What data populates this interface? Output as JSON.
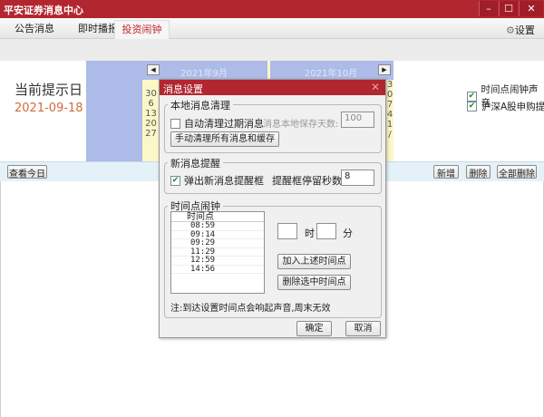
{
  "window": {
    "title": "平安证券消息中心",
    "minimize": "–",
    "maximize": "☐",
    "close": "✕"
  },
  "tabs": [
    {
      "label": "公告消息"
    },
    {
      "label": "即时播报"
    },
    {
      "label": "投资闹钟",
      "active": true
    }
  ],
  "settings": {
    "icon": "gear-icon",
    "label": "设置"
  },
  "left_panel": {
    "label": "当前提示日",
    "date": "2021-09-18"
  },
  "calendar": {
    "month1": "2021年9月",
    "month2": "2021年10月",
    "col1": [
      "30",
      "6",
      "13",
      "20",
      "27"
    ],
    "col2": [
      "3",
      "0",
      "7",
      "4",
      "1",
      "/"
    ]
  },
  "options": [
    {
      "label": "时间点闹钟声音",
      "checked": true
    },
    {
      "label": "沪深A股申购提醒",
      "checked": true
    }
  ],
  "toolbar": {
    "today": "查看今日",
    "add": "新增",
    "delete": "删除",
    "delete_all": "全部删除"
  },
  "dialog": {
    "title": "消息设置",
    "local_cleanup": {
      "title": "本地消息清理",
      "auto_clean_label": "自动清理过期消息",
      "auto_clean_checked": false,
      "keep_days_label": "消息本地保存天数:",
      "keep_days_value": "100",
      "manual_clean": "手动清理所有消息和缓存"
    },
    "new_msg": {
      "title": "新消息提醒",
      "popup_label": "弹出新消息提醒框",
      "popup_checked": true,
      "stay_label": "提醒框停留秒数:",
      "stay_value": "8"
    },
    "alarm": {
      "title": "时间点闹钟",
      "column": "时间点",
      "times": [
        "08:59",
        "09:14",
        "09:29",
        "11:29",
        "12:59",
        "14:56"
      ],
      "hour_label": "时",
      "minute_label": "分",
      "hour_value": "",
      "minute_value": "",
      "add": "加入上述时间点",
      "remove": "删除选中时间点",
      "note": "注:到达设置时间点会响起声音,周末无效"
    },
    "ok": "确定",
    "cancel": "取消"
  },
  "colors": {
    "accent": "#b22630",
    "date": "#d2693a",
    "calendar": "#adbbe9",
    "toolbar": "#e4f1f9"
  }
}
